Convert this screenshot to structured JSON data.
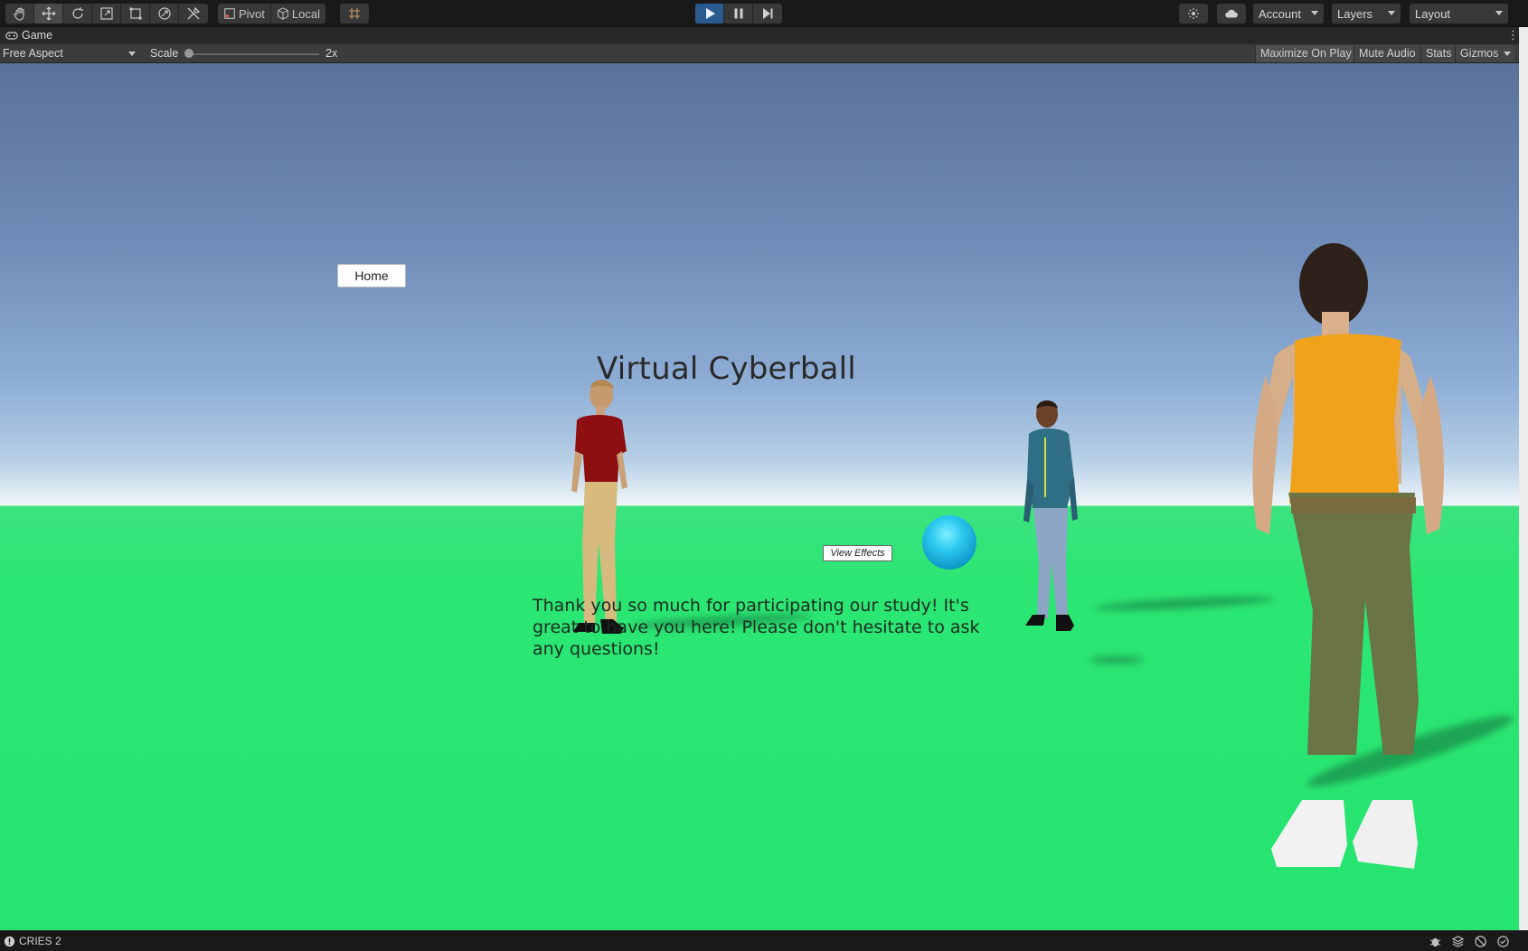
{
  "toolbar": {
    "pivot_label": "Pivot",
    "local_label": "Local",
    "account_label": "Account",
    "layers_label": "Layers",
    "layout_label": "Layout"
  },
  "tab": {
    "game_label": "Game"
  },
  "game_bar": {
    "aspect_label": "Free Aspect",
    "scale_label": "Scale",
    "scale_value": "2x",
    "maximize_label": "Maximize On Play",
    "mute_label": "Mute Audio",
    "stats_label": "Stats",
    "gizmos_label": "Gizmos"
  },
  "game": {
    "home_button": "Home",
    "title": "Virtual Cyberball",
    "view_effects_button": "View Effects",
    "message": "Thank you so much for participating our study! It's great to have you here! Please don't hesitate to ask any questions!"
  },
  "status": {
    "text": "CRIES 2"
  },
  "colors": {
    "sky_top": "#5a7299",
    "ground": "#2be672",
    "ball": "#2bc8ef",
    "play_active": "#2a5b8f"
  }
}
